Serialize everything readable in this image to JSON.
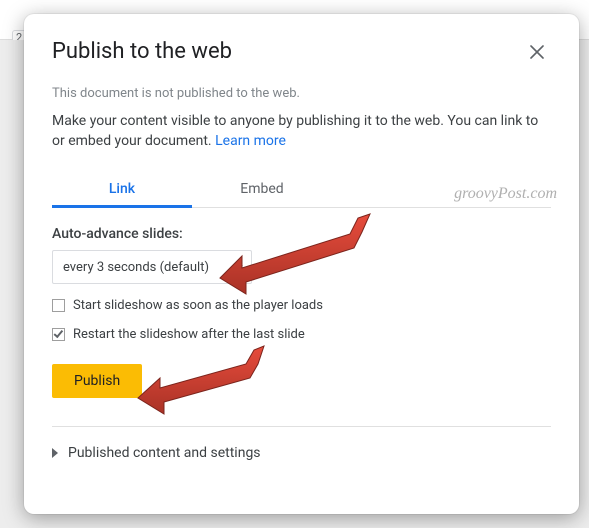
{
  "bg": {
    "chip": "2"
  },
  "dialog": {
    "title": "Publish to the web",
    "status": "This document is not published to the web.",
    "description": "Make your content visible to anyone by publishing it to the web. You can link to or embed your document. ",
    "learn_more": "Learn more"
  },
  "tabs": {
    "link": "Link",
    "embed": "Embed"
  },
  "options": {
    "auto_advance_label": "Auto-advance slides:",
    "auto_advance_value": "every 3 seconds (default)",
    "start_on_load": {
      "label": "Start slideshow as soon as the player loads",
      "checked": false
    },
    "restart_after_last": {
      "label": "Restart the slideshow after the last slide",
      "checked": true
    }
  },
  "actions": {
    "publish": "Publish"
  },
  "expander": {
    "label": "Published content and settings"
  },
  "watermark": "groovyPost.com"
}
